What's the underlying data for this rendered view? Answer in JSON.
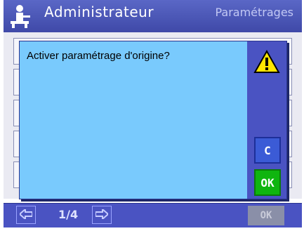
{
  "window": {
    "title": "Administrateur",
    "title_right": "Paramétrages"
  },
  "dialog": {
    "message": "Activer paramétrage d'origine?",
    "cancel_label": "C",
    "ok_label": "OK",
    "warning_icon": "warning-icon"
  },
  "footer": {
    "page": "1/4",
    "ok_label": "OK",
    "prev_icon": "arrow-left-icon",
    "next_icon": "arrow-right-icon"
  },
  "colors": {
    "header": "#4a53c2",
    "dialog_bg": "#79cafd",
    "ok_green": "#0fb50f",
    "c_blue": "#3b5bd6"
  }
}
